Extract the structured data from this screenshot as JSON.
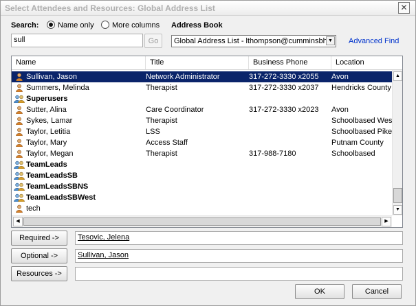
{
  "window": {
    "title": "Select Attendees and Resources: Global Address List",
    "close_glyph": "✕"
  },
  "search": {
    "label": "Search:",
    "value": "sull",
    "go_label": "Go",
    "options": [
      {
        "label": "Name only",
        "checked": true
      },
      {
        "label": "More columns",
        "checked": false
      }
    ]
  },
  "address_book": {
    "label": "Address Book",
    "selected": "Global Address List - lthompson@cumminsbhs.",
    "advanced_find": "Advanced Find"
  },
  "list": {
    "columns": [
      "Name",
      "Title",
      "Business Phone",
      "Location"
    ],
    "rows": [
      {
        "name": "Sullivan,  Jason",
        "title": "Network Administrator",
        "phone": "317-272-3330 x2055",
        "location": "Avon",
        "kind": "person-icon",
        "group": false,
        "selected": true
      },
      {
        "name": "Summers, Melinda",
        "title": "Therapist",
        "phone": "317-272-3330 x2037",
        "location": "Hendricks County",
        "kind": "person-icon",
        "group": false,
        "selected": false
      },
      {
        "name": "Superusers",
        "title": "",
        "phone": "",
        "location": "",
        "kind": "group-icon",
        "group": true,
        "selected": false
      },
      {
        "name": "Sutter,  Alina",
        "title": "Care Coordinator",
        "phone": "317-272-3330 x2023",
        "location": "Avon",
        "kind": "person-icon",
        "group": false,
        "selected": false
      },
      {
        "name": "Sykes,  Lamar",
        "title": "Therapist",
        "phone": "",
        "location": "Schoolbased West",
        "kind": "person-icon",
        "group": false,
        "selected": false
      },
      {
        "name": "Taylor,  Letitia",
        "title": "LSS",
        "phone": "",
        "location": "Schoolbased Pike",
        "kind": "person-icon",
        "group": false,
        "selected": false
      },
      {
        "name": "Taylor,  Mary",
        "title": "Access Staff",
        "phone": "",
        "location": "Putnam County",
        "kind": "person-icon",
        "group": false,
        "selected": false
      },
      {
        "name": "Taylor,  Megan",
        "title": "Therapist",
        "phone": "317-988-7180",
        "location": "Schoolbased",
        "kind": "person-icon",
        "group": false,
        "selected": false
      },
      {
        "name": "TeamLeads",
        "title": "",
        "phone": "",
        "location": "",
        "kind": "group-icon",
        "group": true,
        "selected": false
      },
      {
        "name": "TeamLeadsSB",
        "title": "",
        "phone": "",
        "location": "",
        "kind": "group-icon",
        "group": true,
        "selected": false
      },
      {
        "name": "TeamLeadsSBNS",
        "title": "",
        "phone": "",
        "location": "",
        "kind": "group-icon",
        "group": true,
        "selected": false
      },
      {
        "name": "TeamLeadsSBWest",
        "title": "",
        "phone": "",
        "location": "",
        "kind": "group-icon",
        "group": true,
        "selected": false
      },
      {
        "name": "tech",
        "title": "",
        "phone": "",
        "location": "",
        "kind": "person-icon",
        "group": false,
        "selected": false
      }
    ]
  },
  "recipients": {
    "required_label": "Required ->",
    "required_value": "Tesovic,  Jelena",
    "optional_label": "Optional ->",
    "optional_value": "Sullivan,  Jason",
    "resources_label": "Resources ->",
    "resources_value": ""
  },
  "buttons": {
    "ok": "OK",
    "cancel": "Cancel"
  },
  "colors": {
    "selection": "#0a246a",
    "link": "#0033cc"
  }
}
